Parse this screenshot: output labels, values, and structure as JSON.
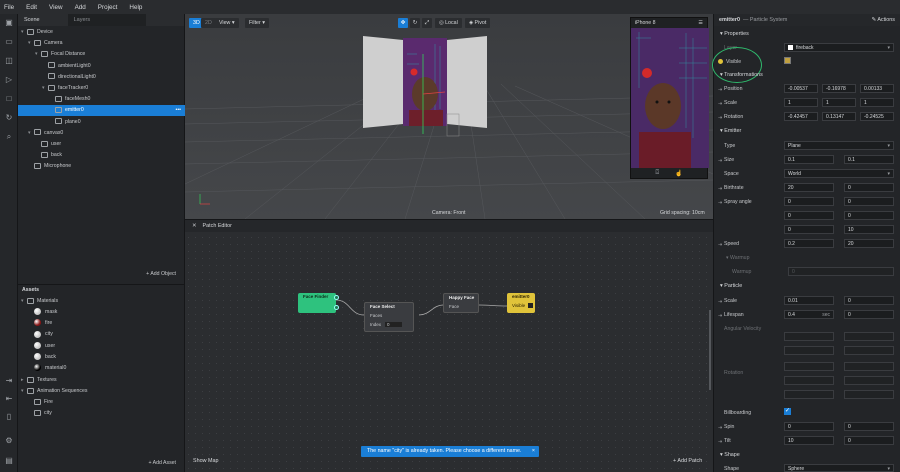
{
  "menu": [
    "File",
    "Edit",
    "View",
    "Add",
    "Project",
    "Help"
  ],
  "scene": {
    "tab": "Scene",
    "layers_tab": "Layers",
    "tree": [
      {
        "label": "Device",
        "depth": 0,
        "arrow": "▾"
      },
      {
        "label": "Camera",
        "depth": 1,
        "arrow": "▾"
      },
      {
        "label": "Focal Distance",
        "depth": 2,
        "arrow": "▾"
      },
      {
        "label": "ambientLight0",
        "depth": 3,
        "arrow": ""
      },
      {
        "label": "directionalLight0",
        "depth": 3,
        "arrow": ""
      },
      {
        "label": "faceTracker0",
        "depth": 3,
        "arrow": "▾"
      },
      {
        "label": "faceMesh0",
        "depth": 4,
        "arrow": ""
      },
      {
        "label": "emitter0",
        "depth": 4,
        "arrow": "",
        "selected": true
      },
      {
        "label": "plane0",
        "depth": 4,
        "arrow": ""
      },
      {
        "label": "canvas0",
        "depth": 1,
        "arrow": "▾"
      },
      {
        "label": "user",
        "depth": 2,
        "arrow": ""
      },
      {
        "label": "back",
        "depth": 2,
        "arrow": ""
      },
      {
        "label": "Microphone",
        "depth": 1,
        "arrow": ""
      }
    ],
    "add_object": "+ Add Object"
  },
  "assets": {
    "title": "Assets",
    "materials_folder": "Materials",
    "materials": [
      {
        "label": "mask",
        "color": "#c8c8c8"
      },
      {
        "label": "fire",
        "color": "#8a1414"
      },
      {
        "label": "city",
        "color": "#c8c8c8"
      },
      {
        "label": "user",
        "color": "#c8c8c8"
      },
      {
        "label": "back",
        "color": "#c8c8c8"
      },
      {
        "label": "material0",
        "color": "#000000"
      }
    ],
    "textures_folder": "Textures",
    "animation_folder": "Animation Sequences",
    "sequences": [
      "Fire",
      "city"
    ],
    "add_asset": "+ Add Asset"
  },
  "viewport": {
    "mode_3d": "3D",
    "mode_2d": "2D",
    "view_btn": "View",
    "filter_btn": "Filter",
    "local_btn": "Local",
    "pivot_btn": "Pivot",
    "device": "iPhone 8",
    "camera_label": "Camera: Front",
    "grid_spacing": "Grid spacing: 10cm"
  },
  "patch_editor": {
    "title": "Patch Editor",
    "show_map": "Show Map",
    "add_patch": "+ Add Patch",
    "face_finder": "Face Finder",
    "face_select": "Face Select",
    "faces_port": "Faces",
    "index_label": "Index",
    "index_value": "0",
    "happy_face": "Happy Face",
    "face_port": "Face",
    "emitter_patch": "emitter0",
    "visible_port": "Visible"
  },
  "inspector": {
    "title": "emitter0",
    "subtitle": "— Particle System",
    "actions": "Actions",
    "sections": {
      "properties": "Properties",
      "transformations": "Transformations",
      "emitter": "Emitter",
      "particle": "Particle",
      "shape": "Shape"
    },
    "layer_label": "Layer",
    "layer_value": "fireback",
    "visible_label": "Visible",
    "position_label": "Position",
    "position": [
      "-0.00537",
      "-0.16978",
      "0.00133"
    ],
    "scale_label": "Scale",
    "scale": [
      "1",
      "1",
      "1"
    ],
    "rotation_label": "Rotation",
    "rotation": [
      "-0.42457",
      "0.13147",
      "-0.24525"
    ],
    "type_label": "Type",
    "type_value": "Plane",
    "size_label": "Size",
    "size": [
      "0.1",
      "0.1"
    ],
    "space_label": "Space",
    "space_value": "World",
    "birthrate_label": "Birthrate",
    "birthrate": [
      "20",
      "0"
    ],
    "spray_label": "Spray angle",
    "spray": [
      "0",
      "0",
      "0",
      "0",
      "0",
      "10"
    ],
    "speed_label": "Speed",
    "speed": [
      "0.2",
      "20"
    ],
    "warmup_section": "Warmup",
    "warmup_label": "Warmup",
    "warmup_value": "0",
    "p_scale_label": "Scale",
    "p_scale": [
      "0.01",
      "0"
    ],
    "lifespan_label": "Lifespan",
    "lifespan": [
      "0.4",
      "0"
    ],
    "lifespan_unit": "sec",
    "angular_label": "Angular Velocity",
    "rotation_p_label": "Rotation",
    "billboarding_label": "Billboarding",
    "spin_label": "Spin",
    "spin": [
      "0",
      "0"
    ],
    "tilt_label": "Tilt",
    "tilt": [
      "10",
      "0"
    ],
    "shape_label": "Shape",
    "shape_value": "Sphere"
  },
  "toast": "The name \"city\" is already taken. Please choose a different name.",
  "toast_close": "×",
  "colors": {
    "accent": "#1a7ed6",
    "annotation": "#2fb86c",
    "face_finder": "#2ec27e",
    "emitter_patch": "#e0c33a"
  }
}
